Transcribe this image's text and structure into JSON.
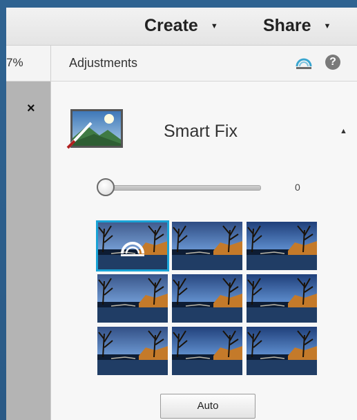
{
  "header": {
    "menus": [
      {
        "label": "Create"
      },
      {
        "label": "Share"
      }
    ]
  },
  "subbar": {
    "zoom_text": "7%",
    "panel_title": "Adjustments",
    "help_glyph": "?"
  },
  "left_panel": {
    "close_glyph": "×"
  },
  "smart_fix": {
    "title": "Smart Fix",
    "slider_value": "0",
    "slider_fraction": 0,
    "auto_label": "Auto",
    "selected_preset": 0,
    "preset_count": 9
  },
  "colors": {
    "accent": "#1aa3d6",
    "frame": "#2c5f8a"
  },
  "icons": {
    "reset": "reset-arc-icon",
    "help": "help-icon",
    "close": "close-icon",
    "collapse": "caret-up-icon",
    "menu_caret": "caret-down-icon"
  }
}
